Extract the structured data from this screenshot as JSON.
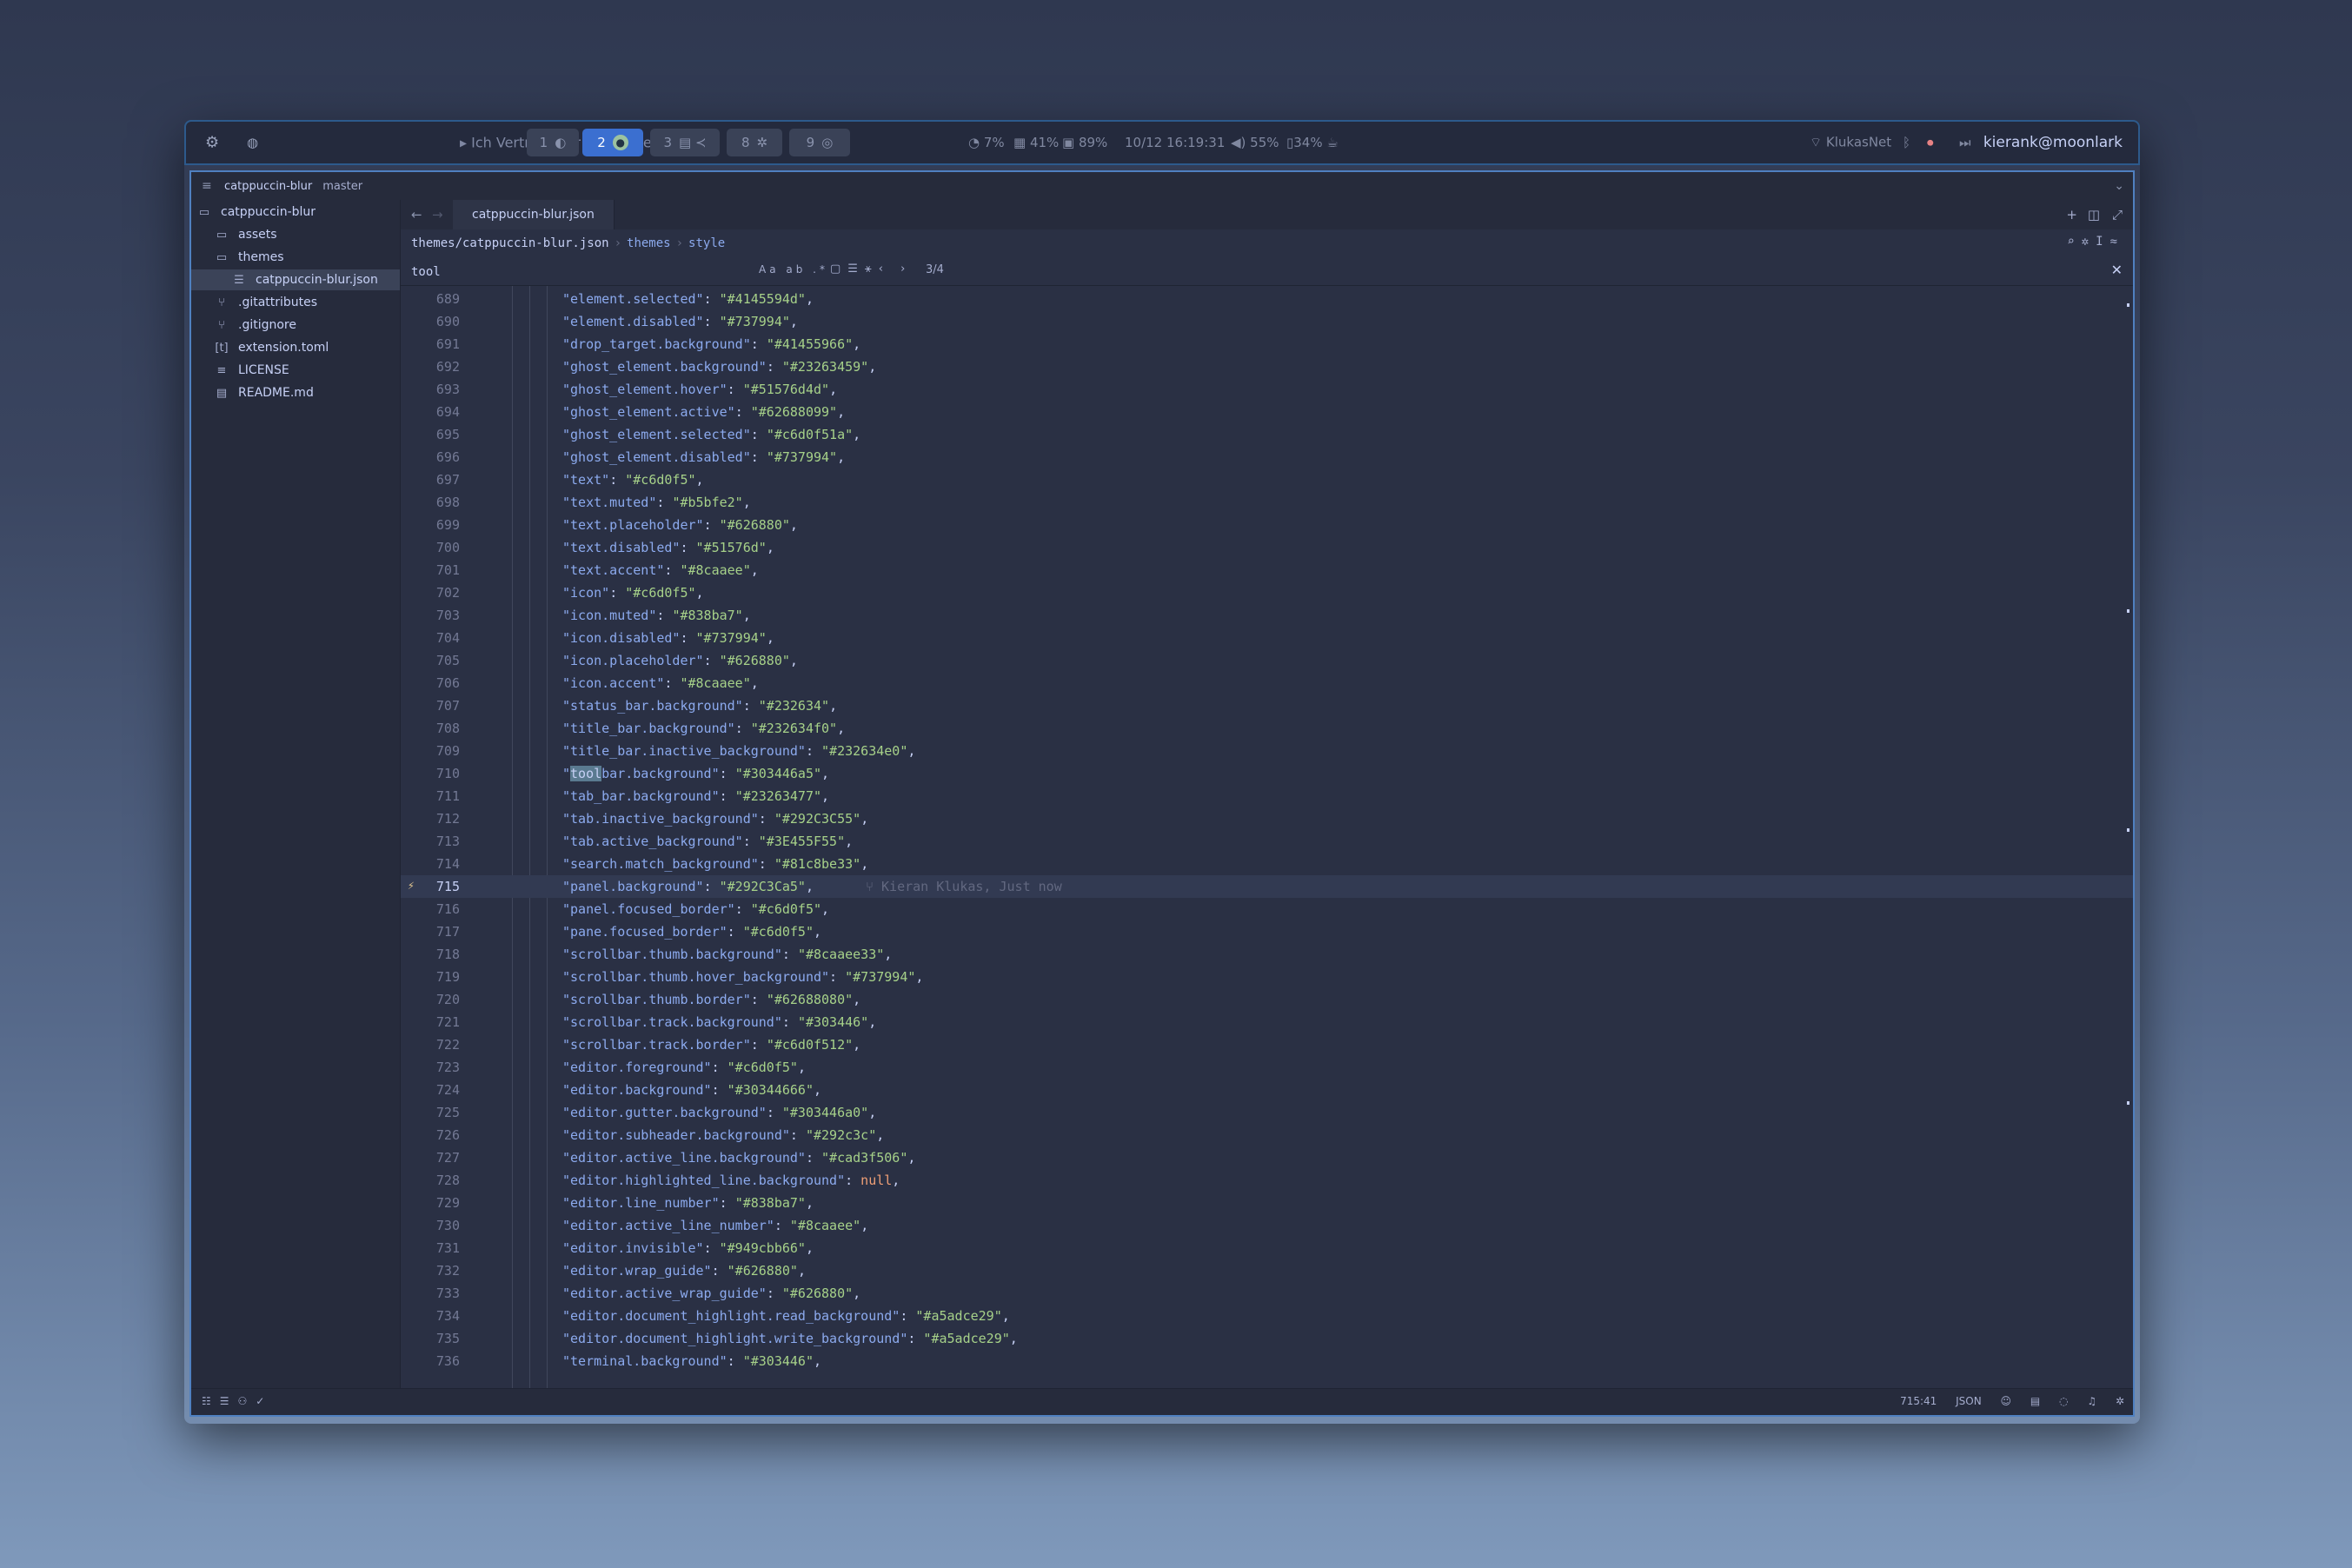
{
  "topbar": {
    "media": "Ich Vertraue Dir Im Dunkeln - Glor...",
    "workspaces": [
      {
        "num": "1",
        "active": false
      },
      {
        "num": "2",
        "active": true
      },
      {
        "num": "3",
        "active": false
      },
      {
        "num": "8",
        "active": false
      },
      {
        "num": "9",
        "active": false
      }
    ],
    "cpu": "7%",
    "mem": "41%",
    "disk": "89%",
    "datetime": "10/12 16:19:31",
    "volume": "55%",
    "battery": "34%",
    "network": "KlukasNet",
    "user": "kierank@moonlark"
  },
  "titlebar": {
    "project": "catppuccin-blur",
    "branch": "master"
  },
  "sidebar": {
    "root": "catppuccin-blur",
    "items": [
      {
        "label": "assets",
        "icon": "folder-icon"
      },
      {
        "label": "themes",
        "icon": "folder-open-icon"
      },
      {
        "label": "catppuccin-blur.json",
        "icon": "json-file-icon"
      },
      {
        "label": ".gitattributes",
        "icon": "git-icon"
      },
      {
        "label": ".gitignore",
        "icon": "git-icon"
      },
      {
        "label": "extension.toml",
        "icon": "toml-file-icon"
      },
      {
        "label": "LICENSE",
        "icon": "license-file-icon"
      },
      {
        "label": "README.md",
        "icon": "markdown-file-icon"
      }
    ]
  },
  "tab": {
    "label": "catppuccin-blur.json"
  },
  "breadcrumb": {
    "file": "themes/catppuccin-blur.json",
    "p1": "themes",
    "p2": "style"
  },
  "search": {
    "query": "tool",
    "count": "3/4"
  },
  "code": {
    "active_line": "715",
    "blame": "Kieran Klukas, Just now",
    "lines": [
      {
        "n": "689",
        "k": "element.selected",
        "v": "\"#4145594d\""
      },
      {
        "n": "690",
        "k": "element.disabled",
        "v": "\"#737994\""
      },
      {
        "n": "691",
        "k": "drop_target.background",
        "v": "\"#41455966\""
      },
      {
        "n": "692",
        "k": "ghost_element.background",
        "v": "\"#23263459\""
      },
      {
        "n": "693",
        "k": "ghost_element.hover",
        "v": "\"#51576d4d\""
      },
      {
        "n": "694",
        "k": "ghost_element.active",
        "v": "\"#62688099\""
      },
      {
        "n": "695",
        "k": "ghost_element.selected",
        "v": "\"#c6d0f51a\""
      },
      {
        "n": "696",
        "k": "ghost_element.disabled",
        "v": "\"#737994\""
      },
      {
        "n": "697",
        "k": "text",
        "v": "\"#c6d0f5\""
      },
      {
        "n": "698",
        "k": "text.muted",
        "v": "\"#b5bfe2\""
      },
      {
        "n": "699",
        "k": "text.placeholder",
        "v": "\"#626880\""
      },
      {
        "n": "700",
        "k": "text.disabled",
        "v": "\"#51576d\""
      },
      {
        "n": "701",
        "k": "text.accent",
        "v": "\"#8caaee\""
      },
      {
        "n": "702",
        "k": "icon",
        "v": "\"#c6d0f5\""
      },
      {
        "n": "703",
        "k": "icon.muted",
        "v": "\"#838ba7\""
      },
      {
        "n": "704",
        "k": "icon.disabled",
        "v": "\"#737994\""
      },
      {
        "n": "705",
        "k": "icon.placeholder",
        "v": "\"#626880\""
      },
      {
        "n": "706",
        "k": "icon.accent",
        "v": "\"#8caaee\""
      },
      {
        "n": "707",
        "k": "status_bar.background",
        "v": "\"#232634\""
      },
      {
        "n": "708",
        "k": "title_bar.background",
        "v": "\"#232634f0\""
      },
      {
        "n": "709",
        "k": "title_bar.inactive_background",
        "v": "\"#232634e0\""
      },
      {
        "n": "710",
        "k": "toolbar.background",
        "v": "\"#303446a5\""
      },
      {
        "n": "711",
        "k": "tab_bar.background",
        "v": "\"#23263477\""
      },
      {
        "n": "712",
        "k": "tab.inactive_background",
        "v": "\"#292C3C55\""
      },
      {
        "n": "713",
        "k": "tab.active_background",
        "v": "\"#3E455F55\""
      },
      {
        "n": "714",
        "k": "search.match_background",
        "v": "\"#81c8be33\""
      },
      {
        "n": "715",
        "k": "panel.background",
        "v": "\"#292C3Ca5\""
      },
      {
        "n": "716",
        "k": "panel.focused_border",
        "v": "\"#c6d0f5\""
      },
      {
        "n": "717",
        "k": "pane.focused_border",
        "v": "\"#c6d0f5\""
      },
      {
        "n": "718",
        "k": "scrollbar.thumb.background",
        "v": "\"#8caaee33\""
      },
      {
        "n": "719",
        "k": "scrollbar.thumb.hover_background",
        "v": "\"#737994\""
      },
      {
        "n": "720",
        "k": "scrollbar.thumb.border",
        "v": "\"#62688080\""
      },
      {
        "n": "721",
        "k": "scrollbar.track.background",
        "v": "\"#303446\""
      },
      {
        "n": "722",
        "k": "scrollbar.track.border",
        "v": "\"#c6d0f512\""
      },
      {
        "n": "723",
        "k": "editor.foreground",
        "v": "\"#c6d0f5\""
      },
      {
        "n": "724",
        "k": "editor.background",
        "v": "\"#30344666\""
      },
      {
        "n": "725",
        "k": "editor.gutter.background",
        "v": "\"#303446a0\""
      },
      {
        "n": "726",
        "k": "editor.subheader.background",
        "v": "\"#292c3c\""
      },
      {
        "n": "727",
        "k": "editor.active_line.background",
        "v": "\"#cad3f506\""
      },
      {
        "n": "728",
        "k": "editor.highlighted_line.background",
        "v": "null"
      },
      {
        "n": "729",
        "k": "editor.line_number",
        "v": "\"#838ba7\""
      },
      {
        "n": "730",
        "k": "editor.active_line_number",
        "v": "\"#8caaee\""
      },
      {
        "n": "731",
        "k": "editor.invisible",
        "v": "\"#949cbb66\""
      },
      {
        "n": "732",
        "k": "editor.wrap_guide",
        "v": "\"#626880\""
      },
      {
        "n": "733",
        "k": "editor.active_wrap_guide",
        "v": "\"#626880\""
      },
      {
        "n": "734",
        "k": "editor.document_highlight.read_background",
        "v": "\"#a5adce29\""
      },
      {
        "n": "735",
        "k": "editor.document_highlight.write_background",
        "v": "\"#a5adce29\""
      },
      {
        "n": "736",
        "k": "terminal.background",
        "v": "\"#303446\""
      }
    ]
  },
  "status": {
    "position": "715:41",
    "language": "JSON"
  }
}
